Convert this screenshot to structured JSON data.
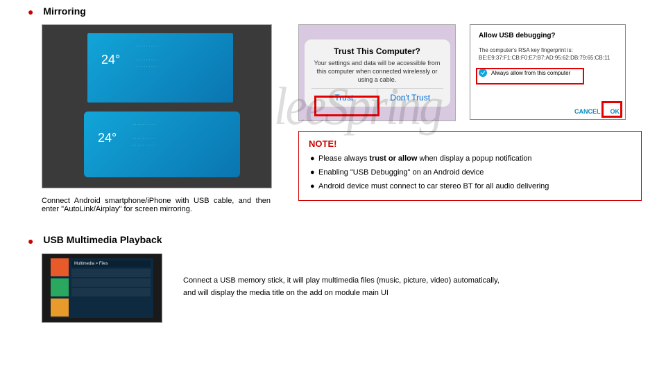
{
  "sections": {
    "mirroring": {
      "title": "Mirroring"
    },
    "usb": {
      "title": "USB Multimedia Playback"
    }
  },
  "mirroring_photo": {
    "temp_top": "24°",
    "temp_bottom": "24°"
  },
  "mirroring_caption": "Connect Android smartphone/iPhone with USB cable, and then enter \"AutoLink/Airplay\" for screen mirroring.",
  "ios_dialog": {
    "title": "Trust This Computer?",
    "body": "Your settings and data will be accessible from this computer when connected wirelessly or using a cable.",
    "trust": "Trust",
    "dont_trust": "Don't Trust"
  },
  "adb_dialog": {
    "title": "Allow USB debugging?",
    "body_line1": "The computer's RSA key fingerprint is:",
    "body_line2": "BE:E9:37:F1:CB:F0:E7:B7:AD:95:62:DB:79:65:CB:11",
    "checkbox_label": "Always allow from this computer",
    "cancel": "CANCEL",
    "ok": "OK"
  },
  "note": {
    "title": "NOTE!",
    "items": [
      "Please always trust or allow when display a popup notification",
      "Enabling \"USB Debugging\" on an Android device",
      "Android device must connect to car stereo BT for all audio delivering"
    ]
  },
  "note_bold_words": {
    "trust_allow": "trust or allow"
  },
  "usb_photo": {
    "breadcrumb": "Multimedia > Files"
  },
  "usb_caption_line1": "Connect a USB memory stick, it will play multimedia files (music, picture, video) automatically,",
  "usb_caption_line2": "and will display the media title on the add on module main UI",
  "watermark": "leeSpring"
}
